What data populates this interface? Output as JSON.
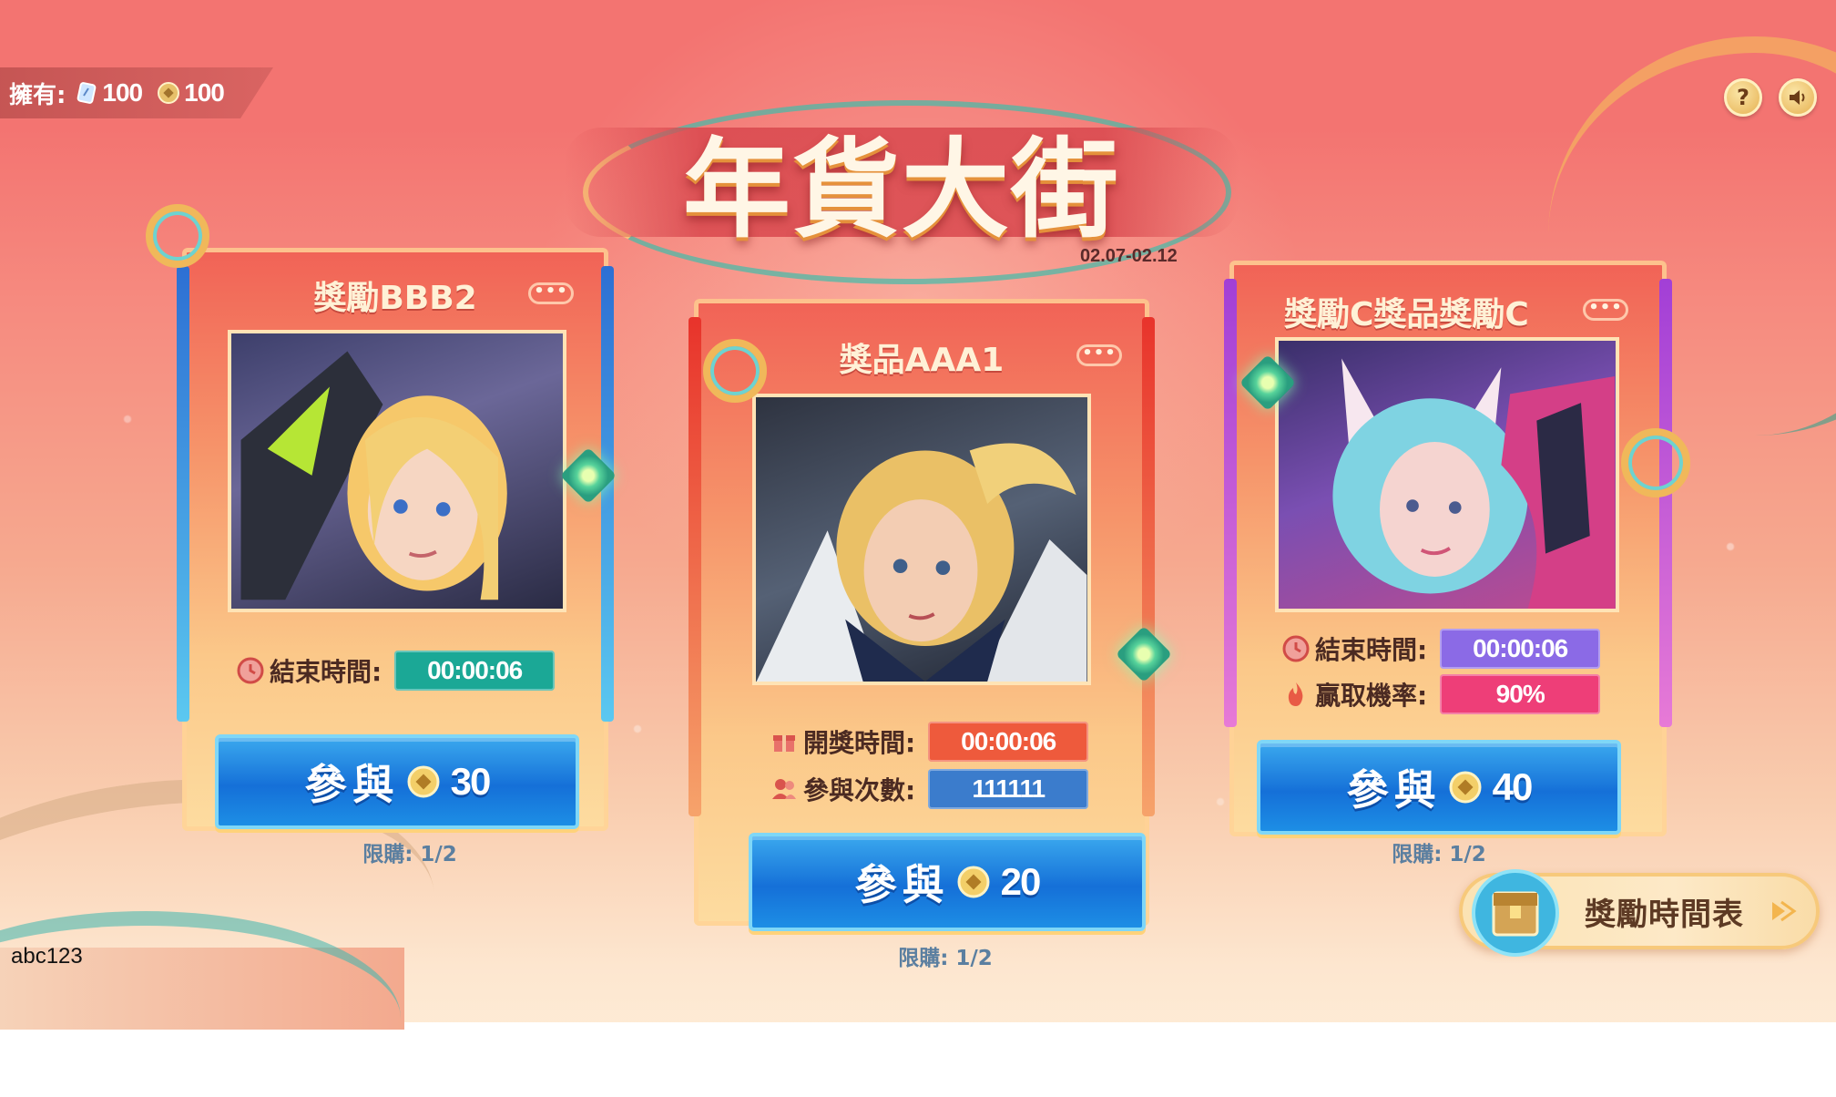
{
  "header": {
    "owned_label": "擁有:",
    "currency_ticket": {
      "icon": "ticket-icon",
      "value": "100"
    },
    "currency_coin": {
      "icon": "coin-icon",
      "value": "100"
    },
    "title": "年貨大街",
    "date_range": "02.07-02.12",
    "help_label": "?",
    "help_icon": "help-icon",
    "sound_icon": "speaker-icon"
  },
  "cards": [
    {
      "title": "獎勵BBB2",
      "more": "•••",
      "rows": [
        {
          "icon": "clock-icon",
          "label": "結束時間:",
          "value": "00:00:06",
          "color": "#1ba896"
        }
      ],
      "join_label": "參與",
      "cost": "30",
      "limit": "限購: 1/2"
    },
    {
      "title": "獎品AAA1",
      "more": "•••",
      "rows": [
        {
          "icon": "gift-icon",
          "label": "開獎時間:",
          "value": "00:00:06",
          "color": "#ee5a3c"
        },
        {
          "icon": "people-icon",
          "label": "參與次數:",
          "value": "111111",
          "color": "#3b7ccc"
        }
      ],
      "join_label": "參與",
      "cost": "20",
      "limit": "限購: 1/2"
    },
    {
      "title": "獎勵C獎品獎勵C",
      "more": "•••",
      "rows": [
        {
          "icon": "clock-icon",
          "label": "結束時間:",
          "value": "00:00:06",
          "color": "#8b6ae6"
        },
        {
          "icon": "flame-icon",
          "label": "贏取機率:",
          "value": "90%",
          "color": "#ee3e78"
        }
      ],
      "join_label": "參與",
      "cost": "40",
      "limit": "限購: 1/2"
    }
  ],
  "schedule": {
    "label": "獎勵時間表",
    "icon": "treasure-chest-icon",
    "arrow_icon": "arrow-right-icon"
  },
  "user": {
    "id": "abc123"
  },
  "colors": {
    "background": "#f37471",
    "button_blue": "#1570d8",
    "title_cream": "#fff6e6"
  }
}
